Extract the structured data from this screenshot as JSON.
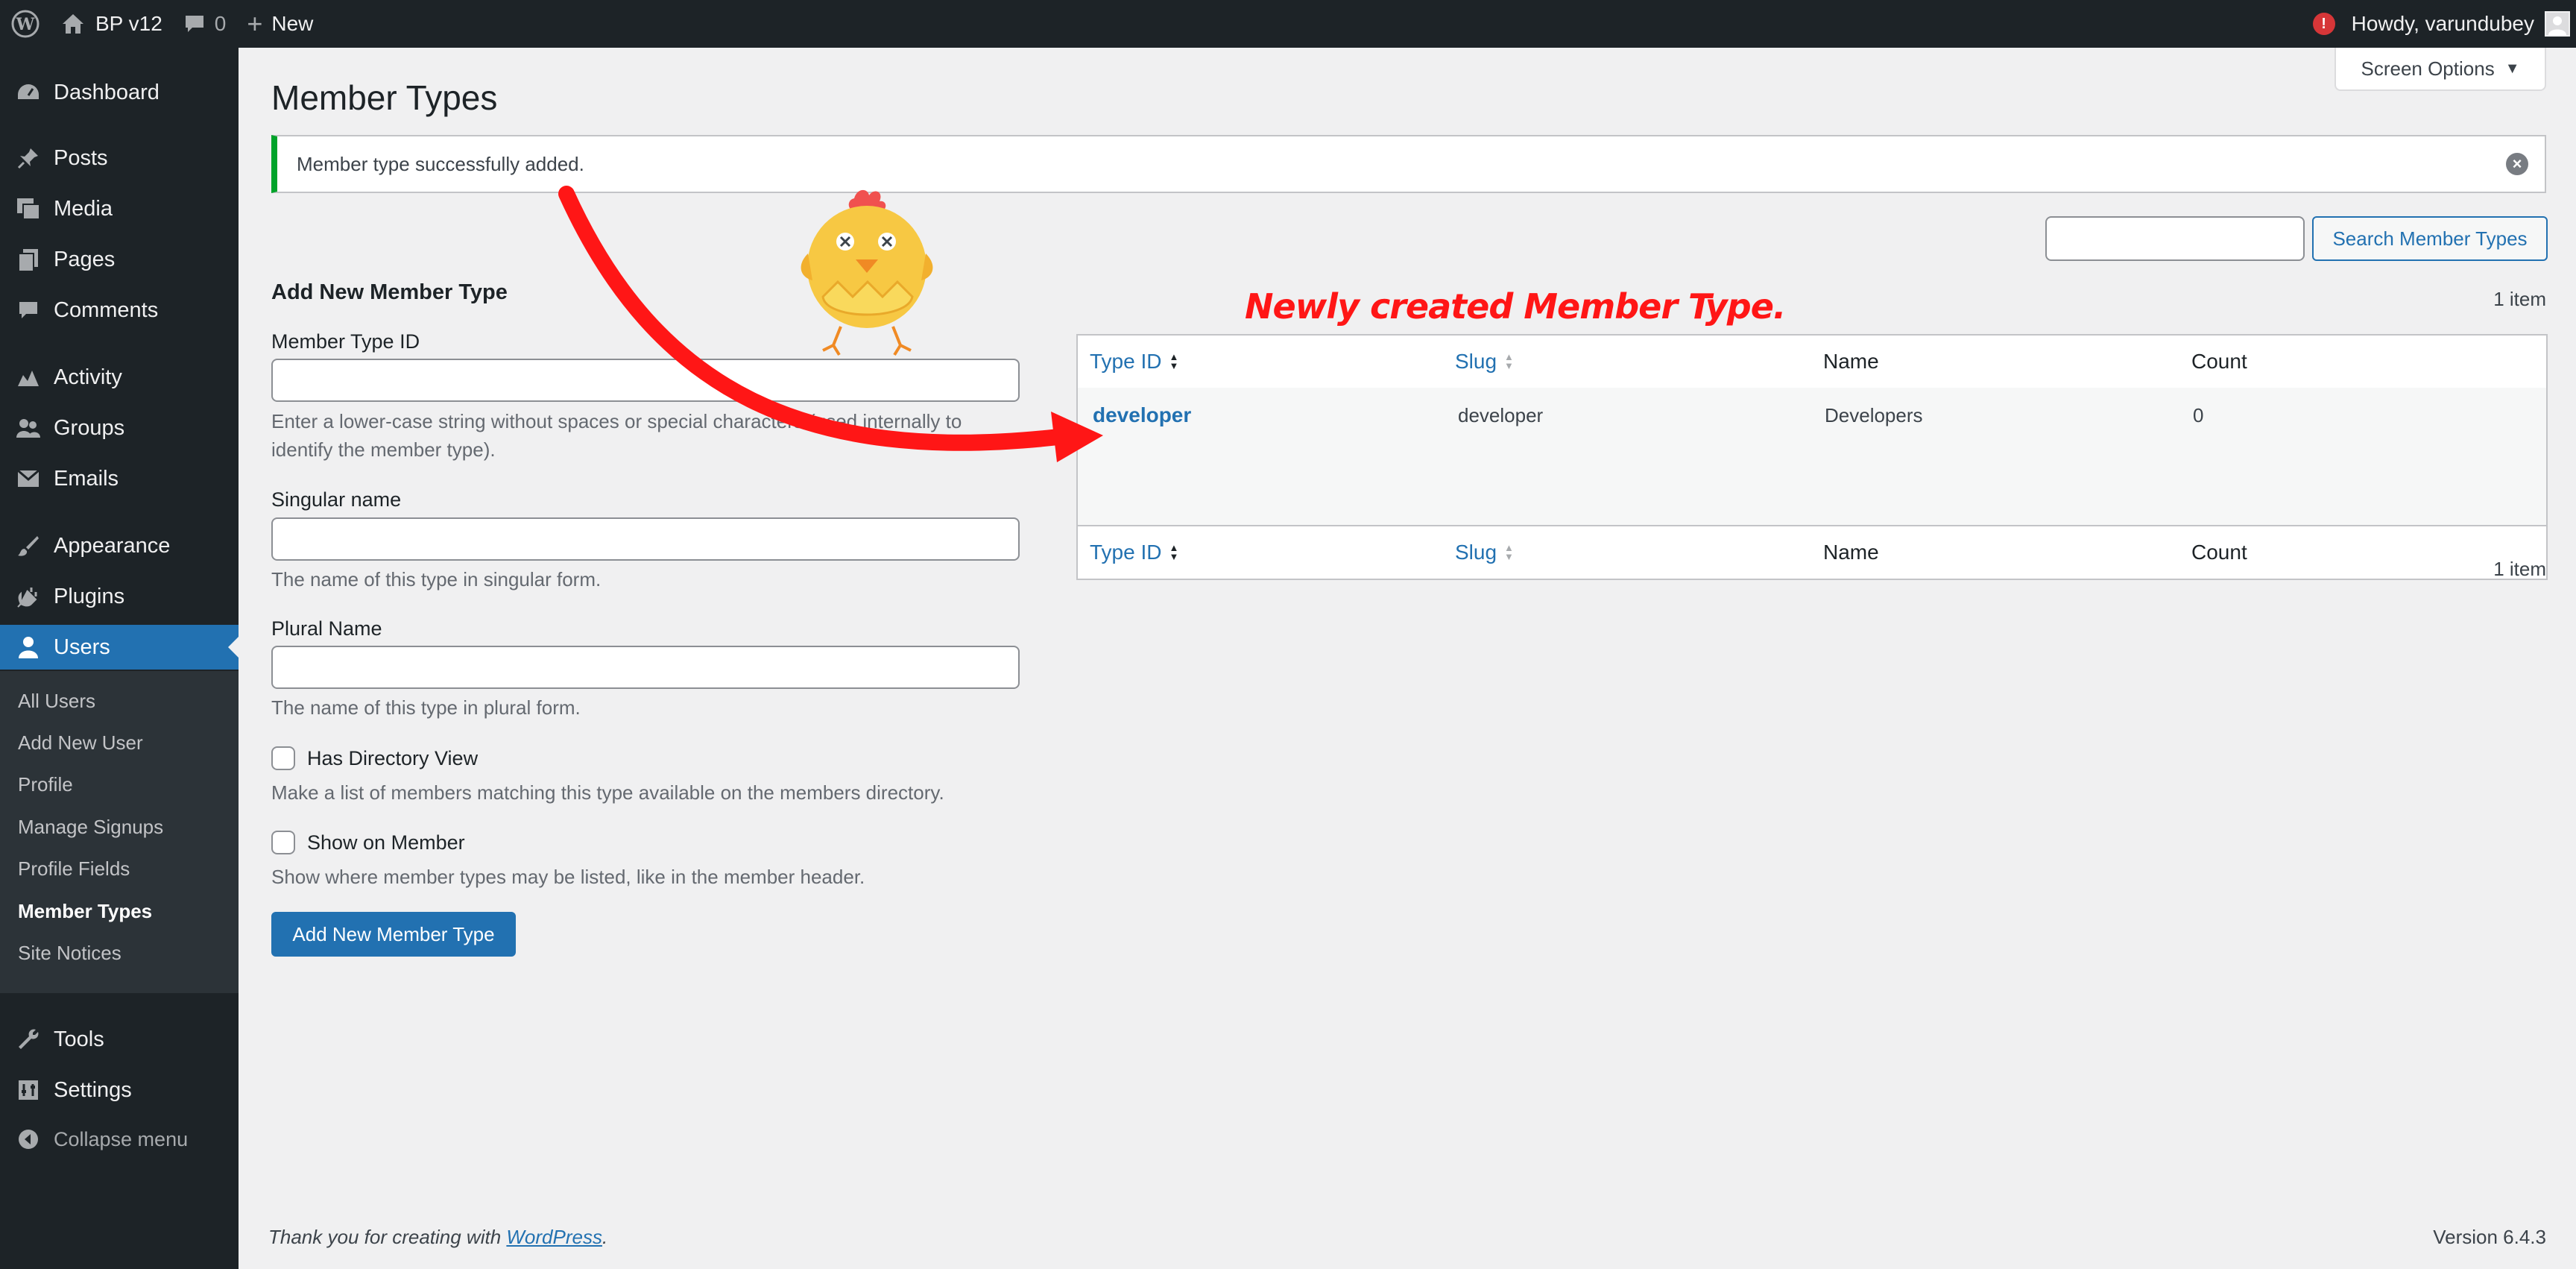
{
  "adminbar": {
    "site_name": "BP v12",
    "comments_count": "0",
    "new_label": "New",
    "greeting": "Howdy, varundubey",
    "notification": "!"
  },
  "sidebar": {
    "items": [
      {
        "label": "Dashboard",
        "icon": "dashboard-icon"
      },
      {
        "label": "Posts",
        "icon": "pin-icon"
      },
      {
        "label": "Media",
        "icon": "media-icon"
      },
      {
        "label": "Pages",
        "icon": "pages-icon"
      },
      {
        "label": "Comments",
        "icon": "comment-icon"
      },
      {
        "label": "Activity",
        "icon": "activity-icon"
      },
      {
        "label": "Groups",
        "icon": "groups-icon"
      },
      {
        "label": "Emails",
        "icon": "mail-icon"
      },
      {
        "label": "Appearance",
        "icon": "brush-icon"
      },
      {
        "label": "Plugins",
        "icon": "plug-icon"
      },
      {
        "label": "Users",
        "icon": "user-icon"
      },
      {
        "label": "Tools",
        "icon": "wrench-icon"
      },
      {
        "label": "Settings",
        "icon": "settings-icon"
      }
    ],
    "submenu": [
      "All Users",
      "Add New User",
      "Profile",
      "Manage Signups",
      "Profile Fields",
      "Member Types",
      "Site Notices"
    ],
    "collapse_label": "Collapse menu"
  },
  "page": {
    "title": "Member Types",
    "screen_options": "Screen Options",
    "notice": "Member type successfully added."
  },
  "form": {
    "title": "Add New Member Type",
    "id_label": "Member Type ID",
    "id_desc": "Enter a lower-case string without spaces or special characters (used internally to identify the member type).",
    "singular_label": "Singular name",
    "singular_desc": "The name of this type in singular form.",
    "plural_label": "Plural Name",
    "plural_desc": "The name of this type in plural form.",
    "directory_label": "Has Directory View",
    "directory_desc": "Make a list of members matching this type available on the members directory.",
    "show_label": "Show on Member",
    "show_desc": "Show where member types may be listed, like in the member header.",
    "submit": "Add New Member Type"
  },
  "list": {
    "search_button": "Search Member Types",
    "count_top": "1 item",
    "count_bottom": "1 item",
    "columns": [
      "Type ID",
      "Slug",
      "Name",
      "Count"
    ],
    "rows": [
      {
        "type_id": "developer",
        "slug": "developer",
        "name": "Developers",
        "count": "0"
      }
    ]
  },
  "annotation": {
    "text": "Newly created Member Type."
  },
  "footer": {
    "thanks_prefix": "Thank you for creating with ",
    "thanks_link": "WordPress",
    "thanks_suffix": ".",
    "version": "Version 6.4.3"
  }
}
